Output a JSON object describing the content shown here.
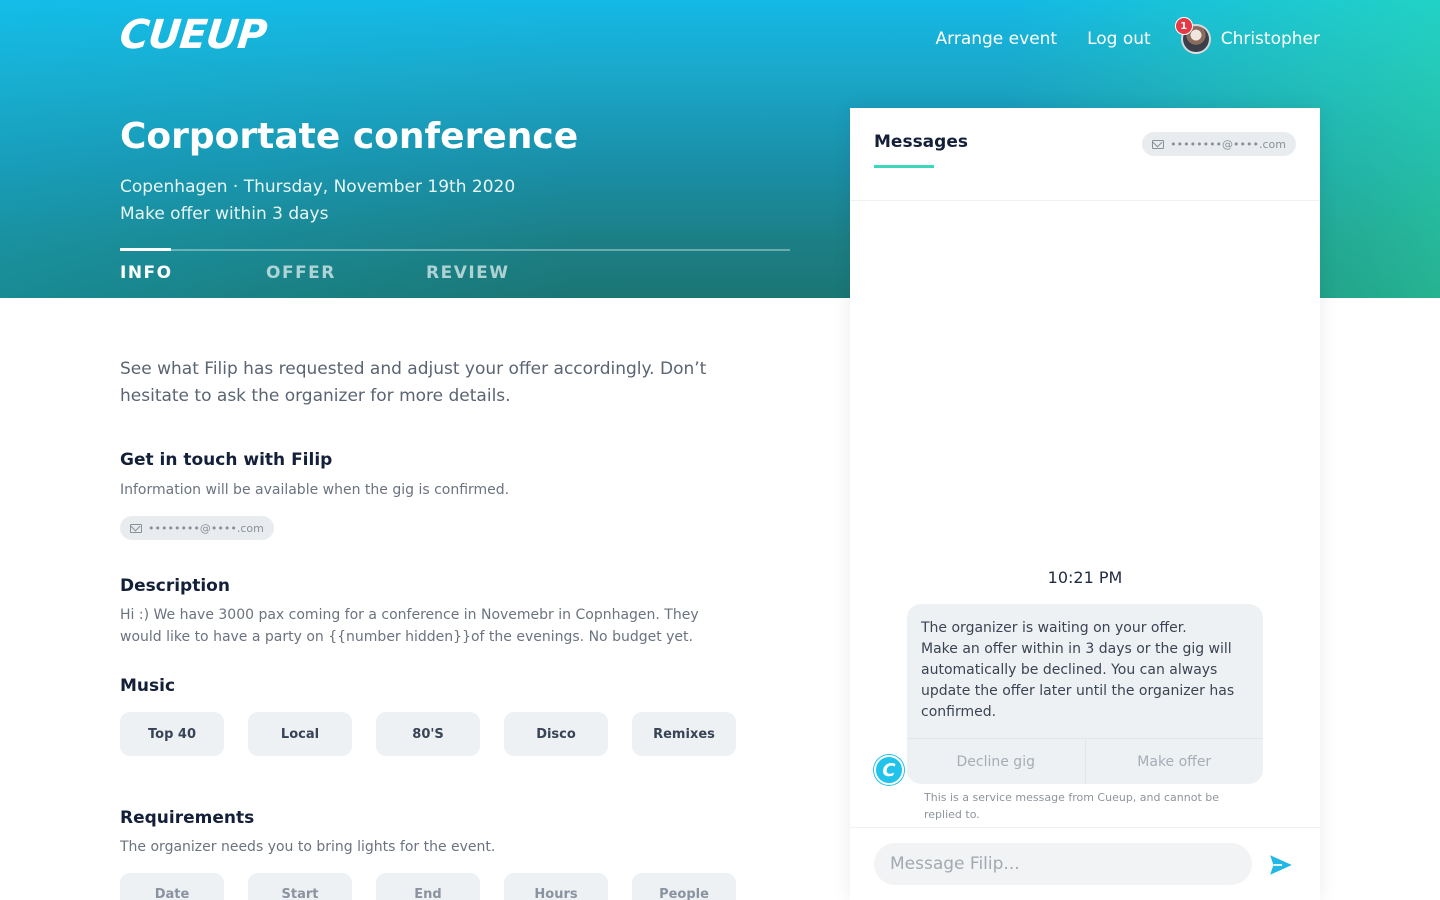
{
  "brand": {
    "logo": "CUEUP"
  },
  "nav": {
    "arrange_event": "Arrange event",
    "log_out": "Log out",
    "user_name": "Christopher",
    "notification_count": "1"
  },
  "event": {
    "title": "Corportate conference",
    "subtitle_line1": "Copenhagen · Thursday, November 19th 2020",
    "subtitle_line2": "Make offer within 3 days"
  },
  "tabs": [
    {
      "label": "INFO",
      "active": true
    },
    {
      "label": "OFFER",
      "active": false
    },
    {
      "label": "REVIEW",
      "active": false
    }
  ],
  "info": {
    "intro": "See what Filip has requested and adjust your offer accordingly. Don’t hesitate to ask the organizer for more details.",
    "contact_heading": "Get in touch with Filip",
    "contact_note": "Information will be available when the gig is confirmed.",
    "contact_email": "••••••••@••••.com",
    "description_heading": "Description",
    "description_text": "Hi :) We have 3000 pax coming for a conference in Novemebr in Copnhagen. They would like to have a party on {{number hidden}}of the evenings. No budget yet.",
    "music_heading": "Music",
    "music_tags": [
      "Top 40",
      "Local",
      "80'S",
      "Disco",
      "Remixes"
    ],
    "requirements_heading": "Requirements",
    "requirements_text": "The organizer needs you to bring lights for the event.",
    "requirement_columns": [
      "Date",
      "Start",
      "End",
      "Hours",
      "People"
    ]
  },
  "messages": {
    "title": "Messages",
    "email": "••••••••@••••.com",
    "time": "10:21 PM",
    "bubble_text": "The organizer is waiting on your offer.\nMake an offer within in 3 days or the gig will automatically be declined. You can always update the offer later until the organizer has confirmed.",
    "decline_label": "Decline gig",
    "offer_label": "Make offer",
    "bot_initial": "C",
    "service_note": "This is a service message from Cueup, and cannot be replied to.",
    "composer_placeholder": "Message Filip..."
  },
  "colors": {
    "accent": "#3cd6b8",
    "hero_top": "#14b9e6",
    "hero_bottom": "#1b7674",
    "notification": "#e53945",
    "send": "#21b8e8"
  },
  "icons": [
    "envelope-icon",
    "send-icon",
    "avatar",
    "cueup-bot-icon"
  ]
}
